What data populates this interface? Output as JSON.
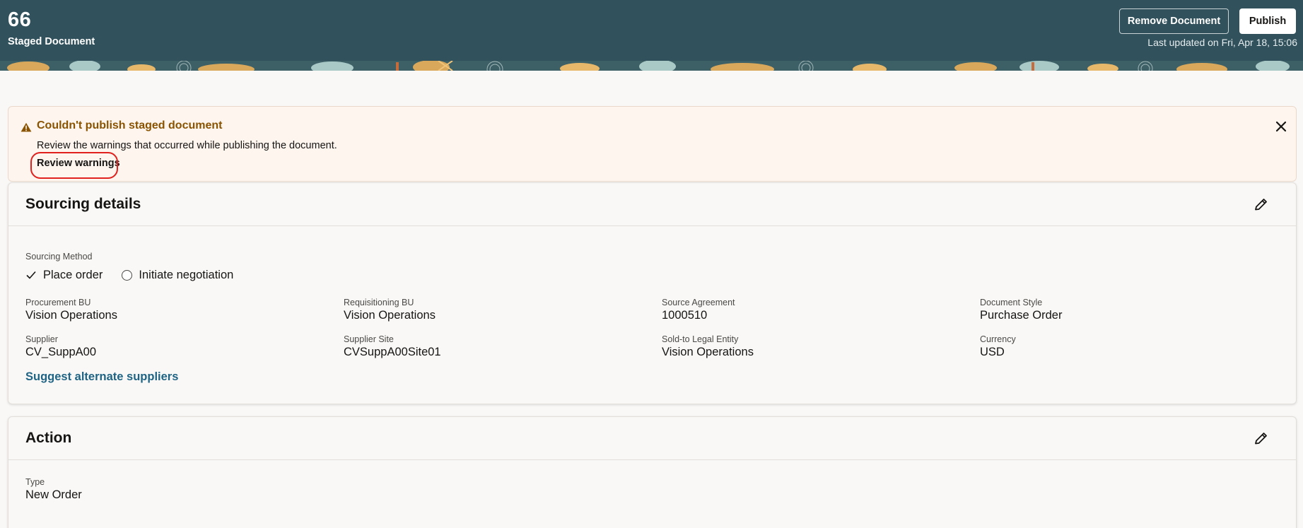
{
  "header": {
    "document_number": "66",
    "subtitle": "Staged Document",
    "remove_label": "Remove Document",
    "publish_label": "Publish",
    "last_updated": "Last updated on Fri, Apr 18, 15:06",
    "colors": {
      "background": "#31525c"
    }
  },
  "warning": {
    "title": "Couldn't publish staged document",
    "message": "Review the warnings that occurred while publishing the document.",
    "link_label": "Review warnings",
    "icon": "warning-triangle-icon",
    "close_icon": "close-icon",
    "colors": {
      "title": "#8a5300",
      "background": "#fdf5ee",
      "annotation": "#e0211d"
    }
  },
  "sourcing": {
    "title": "Sourcing details",
    "method_label": "Sourcing Method",
    "options": [
      {
        "label": "Place order",
        "selected": true
      },
      {
        "label": "Initiate negotiation",
        "selected": false
      }
    ],
    "fields": [
      {
        "label": "Procurement BU",
        "value": "Vision Operations"
      },
      {
        "label": "Requisitioning BU",
        "value": "Vision Operations"
      },
      {
        "label": "Source Agreement",
        "value": "1000510"
      },
      {
        "label": "Document Style",
        "value": "Purchase Order"
      },
      {
        "label": "Supplier",
        "value": "CV_SuppA00"
      },
      {
        "label": "Supplier Site",
        "value": "CVSuppA00Site01"
      },
      {
        "label": "Sold-to Legal Entity",
        "value": "Vision Operations"
      },
      {
        "label": "Currency",
        "value": "USD"
      }
    ],
    "suggest_link": "Suggest alternate suppliers",
    "edit_icon": "pencil-icon",
    "colors": {
      "link": "#1f6484"
    }
  },
  "action": {
    "title": "Action",
    "type_label": "Type",
    "type_value": "New Order",
    "edit_icon": "pencil-icon"
  }
}
